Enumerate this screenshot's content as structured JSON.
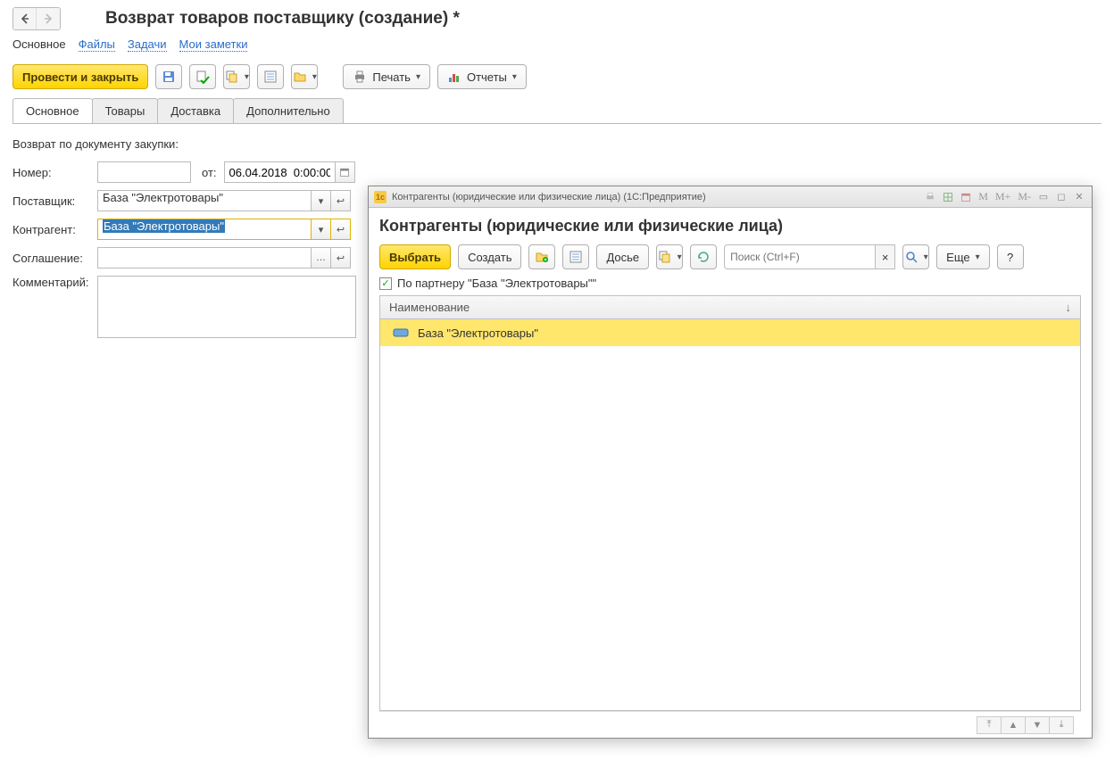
{
  "header": {
    "title": "Возврат товаров поставщику (создание) *"
  },
  "section_nav": {
    "main": "Основное",
    "files": "Файлы",
    "tasks": "Задачи",
    "notes": "Мои заметки"
  },
  "toolbar": {
    "post_and_close": "Провести и закрыть",
    "print": "Печать",
    "reports": "Отчеты"
  },
  "tabs": {
    "main": "Основное",
    "goods": "Товары",
    "delivery": "Доставка",
    "extra": "Дополнительно"
  },
  "form": {
    "return_doc_label": "Возврат по документу закупки:",
    "number_label": "Номер:",
    "number_value": "",
    "from_label": "от:",
    "date_value": "06.04.2018  0:00:00",
    "supplier_label": "Поставщик:",
    "supplier_value": "База \"Электротовары\"",
    "counterparty_label": "Контрагент:",
    "counterparty_value": "База \"Электротовары\"",
    "agreement_label": "Соглашение:",
    "agreement_value": "",
    "comment_label": "Комментарий:",
    "comment_value": ""
  },
  "popup": {
    "titlebar": "Контрагенты (юридические или физические лица)  (1С:Предприятие)",
    "title_m": "M",
    "title_mplus": "M+",
    "title_mminus": "M-",
    "heading": "Контрагенты (юридические или физические лица)",
    "select": "Выбрать",
    "create": "Создать",
    "dossier": "Досье",
    "search_placeholder": "Поиск (Ctrl+F)",
    "more": "Еще",
    "help": "?",
    "filter_label": "По партнеру \"База \"Электротовары\"\"",
    "col_name": "Наименование",
    "rows": {
      "0": {
        "name": "База \"Электротовары\""
      }
    }
  }
}
